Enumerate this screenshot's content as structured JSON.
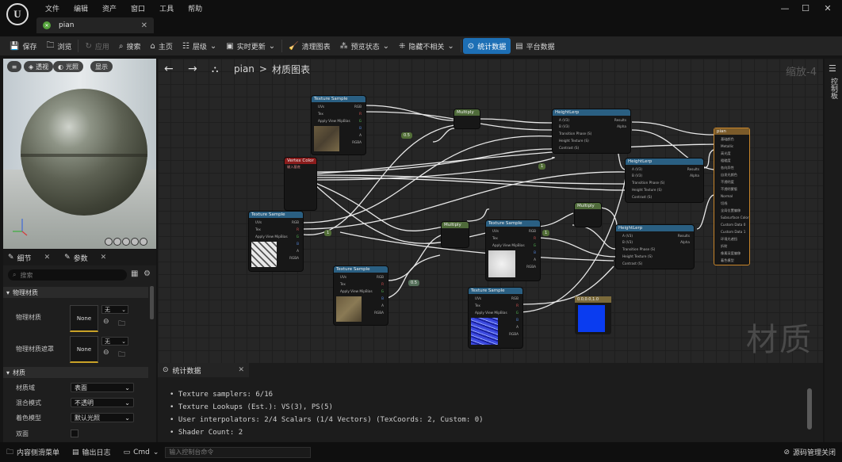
{
  "menu": [
    "文件",
    "编辑",
    "资产",
    "窗口",
    "工具",
    "帮助"
  ],
  "tab": {
    "name": "pian"
  },
  "toolbar": {
    "save": "保存",
    "browse": "浏览",
    "apply": "应用",
    "search": "搜索",
    "home": "主页",
    "hierarchy": "层级",
    "live_update": "实时更新",
    "clean_graph": "清理图表",
    "preview_state": "预览状态",
    "hide_unrelated": "隐藏不相关",
    "stats": "统计数据",
    "platform_stats": "平台数据"
  },
  "viewport": {
    "perspective": "透视",
    "lit": "光照",
    "show": "显示"
  },
  "details": {
    "tab_details": "细节",
    "tab_params": "参数",
    "search_placeholder": "搜索",
    "section_physical": "物理材质",
    "phys_mat_label": "物理材质",
    "phys_mat_value": "None",
    "phys_mask_label": "物理材质遮罩",
    "phys_mask_value": "None",
    "mini_dd_value": "无",
    "section_material": "材质",
    "domain_label": "材质域",
    "domain_value": "表面",
    "blend_label": "混合模式",
    "blend_value": "不透明",
    "shading_label": "着色模型",
    "shading_value": "默认光照",
    "twosided_label": "双面"
  },
  "graph": {
    "crumb_root": "pian",
    "crumb_sep": ">",
    "crumb_page": "材质图表",
    "zoom": "缩放-4",
    "watermark": "材质",
    "nodes": {
      "tex1": "Texture Sample",
      "tex2": "Texture Sample",
      "tex3": "Texture Sample",
      "tex4": "Texture Sample",
      "tex5": "Texture Sample",
      "vc_title": "Vertex Color",
      "vc_sub": "输入基底",
      "mul1": "Multiply",
      "mul2": "Multiply",
      "mul3": "Multiply",
      "hl1": "HeightLerp",
      "hl2": "HeightLerp",
      "hl3": "HeightLerp",
      "result": "pian",
      "const1": "0.5",
      "const2": "1",
      "const3": "1",
      "const4": "0.5",
      "const5": "1",
      "color": "0.0,0.0,1.0"
    },
    "pins_tex": [
      "UVs",
      "Tex",
      "Apply View MipBias"
    ],
    "pins_tex_out": [
      "RGB",
      "R",
      "G",
      "B",
      "A",
      "RGBA"
    ],
    "pins_hl": [
      "A (V3)",
      "B (V3)",
      "Transition Phase (S)",
      "Height Texture (S)",
      "Contrast (S)"
    ],
    "pins_hl_out": [
      "Results",
      "Alpha"
    ],
    "pins_result": [
      "基础颜色",
      "Metallic",
      "高光度",
      "粗糙度",
      "各向异性",
      "自发光颜色",
      "不透明度",
      "不透明蒙版",
      "Normal",
      "切线",
      "全局位置偏移",
      "Subsurface Color",
      "Custom Data 0",
      "Custom Data 1",
      "环境光遮挡",
      "折射",
      "像素深度偏移",
      "着色模型"
    ]
  },
  "stats": {
    "tab": "统计数据",
    "lines": [
      "Texture samplers: 6/16",
      "Texture Lookups (Est.): VS(3), PS(5)",
      "User interpolators: 2/4 Scalars (1/4 Vectors) (TexCoords: 2, Custom: 0)",
      "Shader Count: 2"
    ]
  },
  "right_bar": {
    "label": "控制板"
  },
  "bottombar": {
    "content_drawer": "内容侧滑菜单",
    "output_log": "输出日志",
    "cmd": "Cmd",
    "cmd_placeholder": "输入控制台命令",
    "source_control": "源码管理关闭"
  },
  "colors": {
    "accent": "#1d6fb5",
    "result_border": "#c7852a",
    "blue_swatch": "#0a3cf0"
  }
}
